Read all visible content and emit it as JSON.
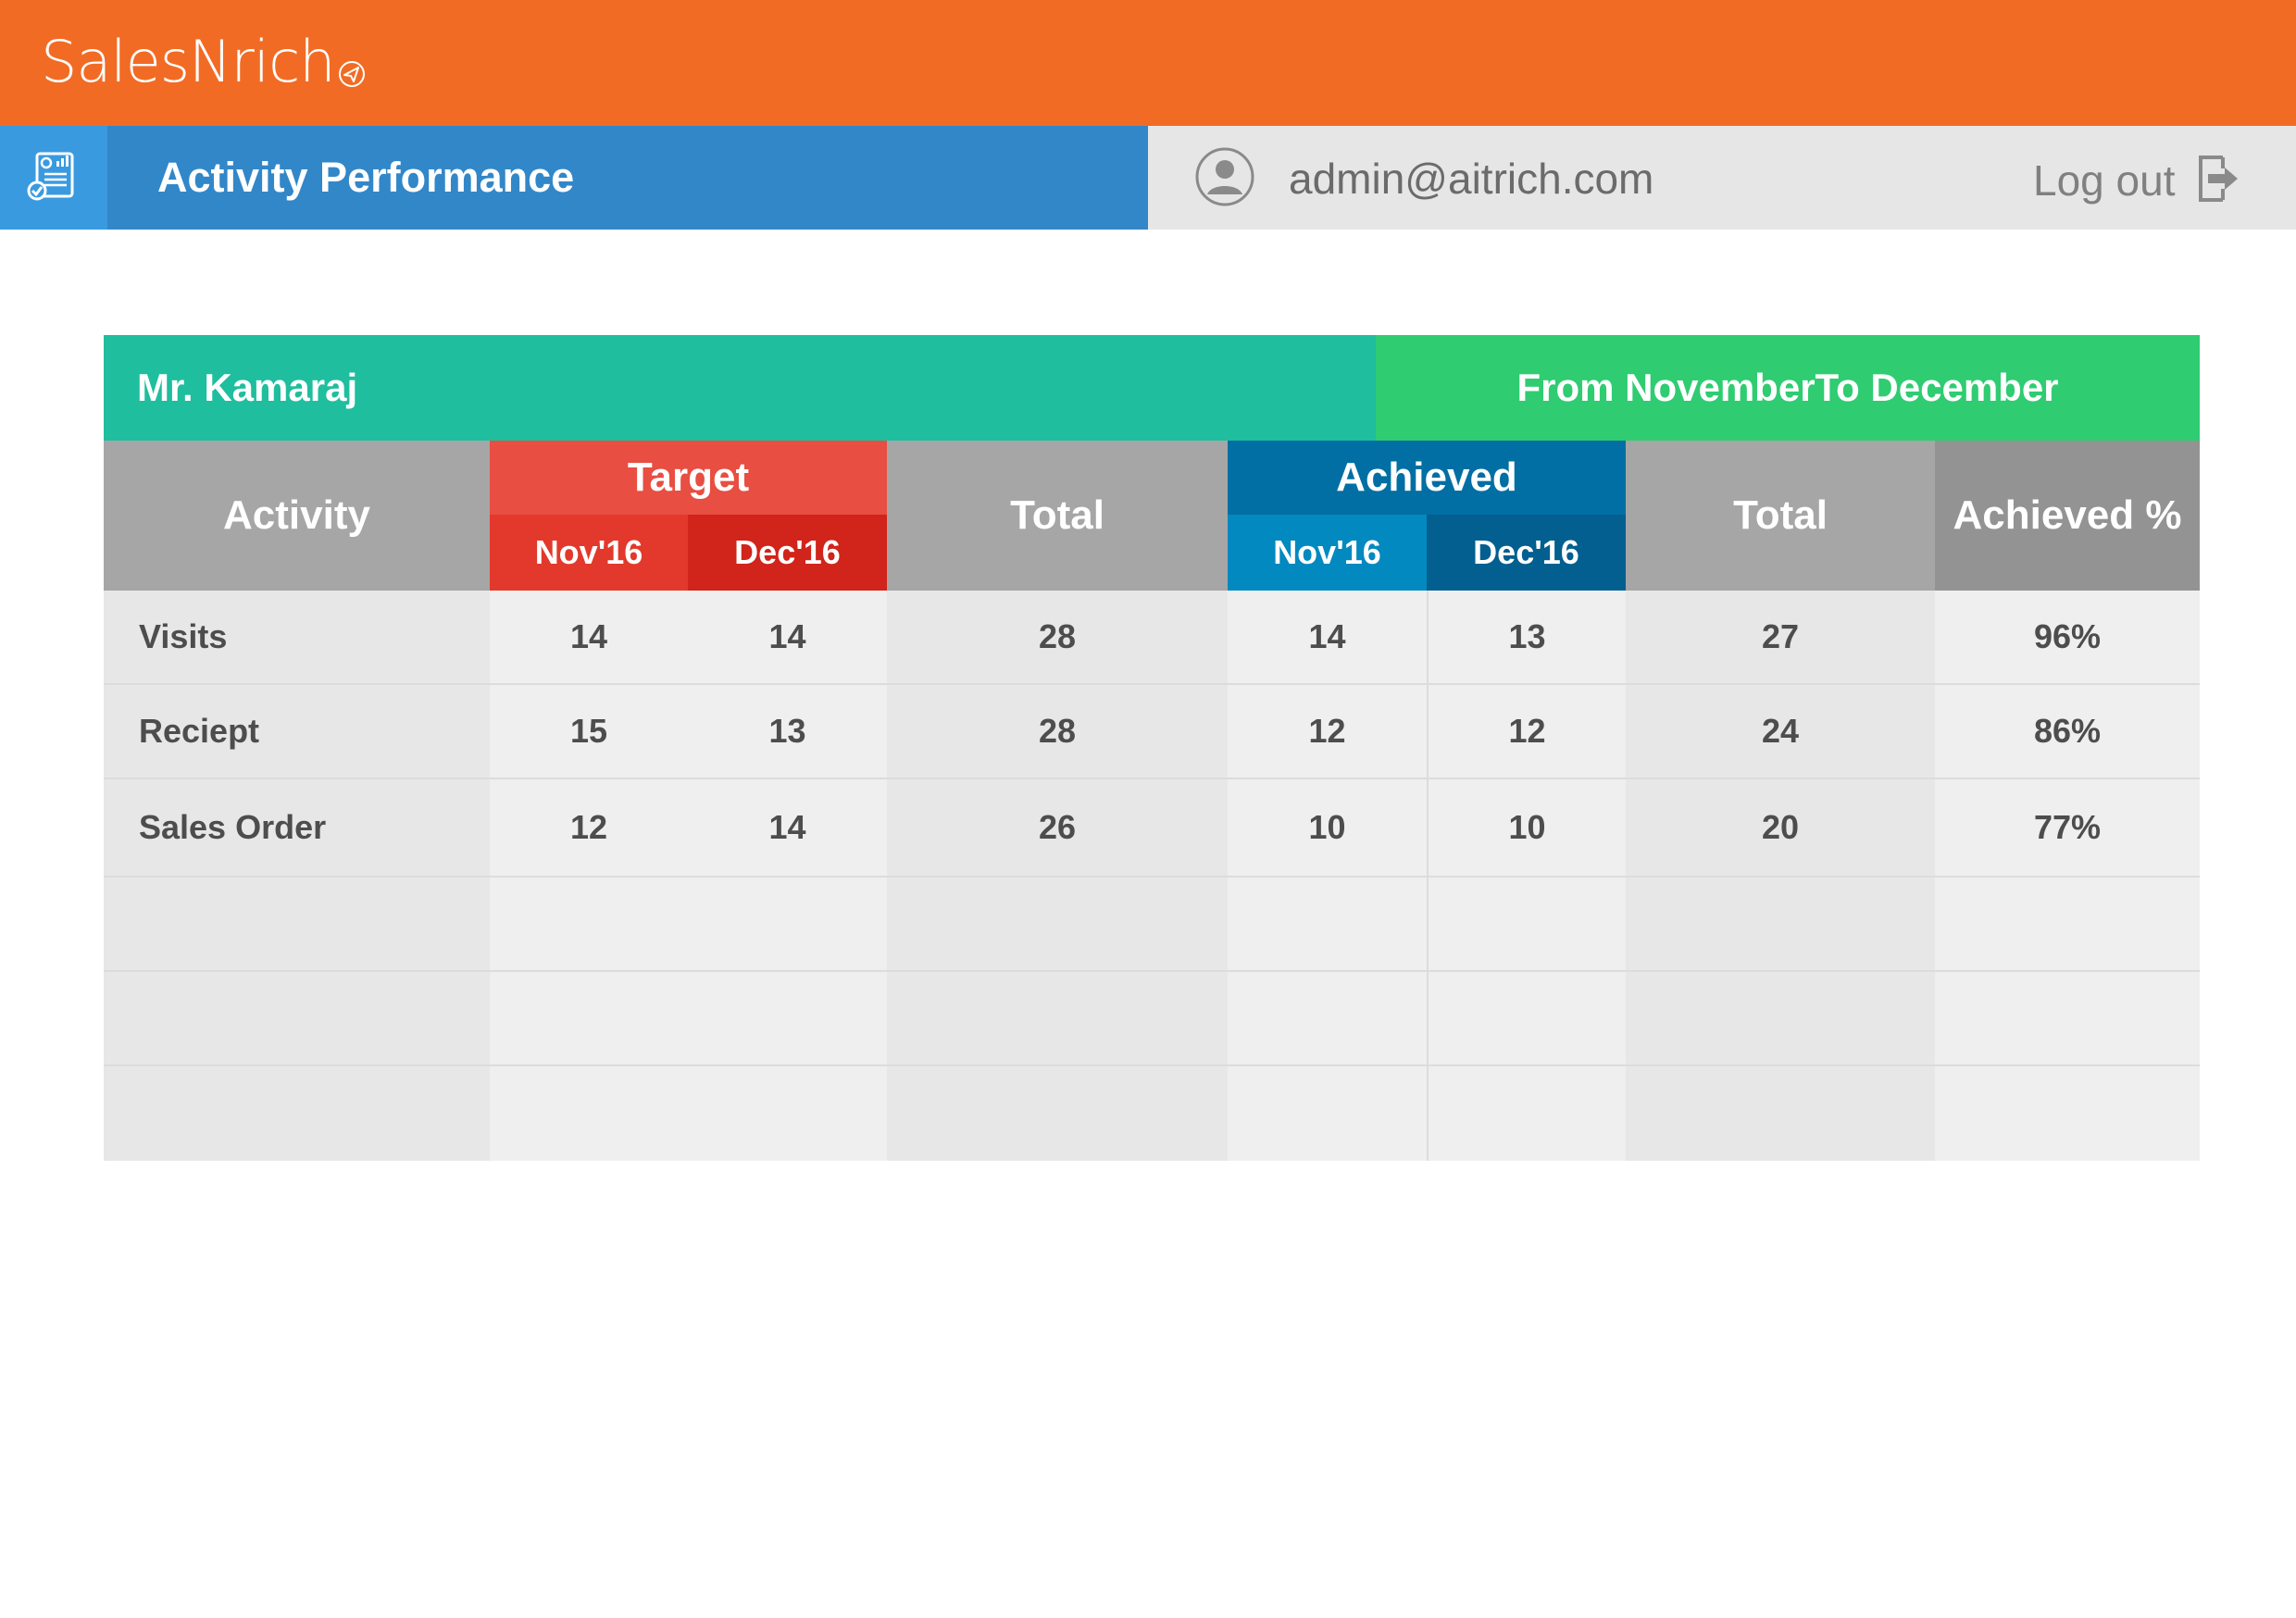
{
  "app": {
    "name": "SalesNrich"
  },
  "header": {
    "page_title": "Activity Performance",
    "user_email": "admin@aitrich.com",
    "logout_label": "Log out"
  },
  "report": {
    "person": "Mr. Kamaraj",
    "range": "From NovemberTo December",
    "columns": {
      "activity": "Activity",
      "target": "Target",
      "target_months": [
        "Nov'16",
        "Dec'16"
      ],
      "target_total": "Total",
      "achieved": "Achieved",
      "achieved_months": [
        "Nov'16",
        "Dec'16"
      ],
      "achieved_total": "Total",
      "achieved_pct": "Achieved %"
    },
    "rows": [
      {
        "activity": "Visits",
        "target_nov": "14",
        "target_dec": "14",
        "target_total": "28",
        "ach_nov": "14",
        "ach_dec": "13",
        "ach_total": "27",
        "pct": "96%"
      },
      {
        "activity": "Reciept",
        "target_nov": "15",
        "target_dec": "13",
        "target_total": "28",
        "ach_nov": "12",
        "ach_dec": "12",
        "ach_total": "24",
        "pct": "86%"
      },
      {
        "activity": "Sales Order",
        "target_nov": "12",
        "target_dec": "14",
        "target_total": "26",
        "ach_nov": "10",
        "ach_dec": "10",
        "ach_total": "20",
        "pct": "77%"
      }
    ]
  },
  "colors": {
    "brand_orange": "#f26b24",
    "title_blue": "#3287c9",
    "person_teal": "#1fbe9e",
    "range_green": "#2fcc72",
    "target_red": "#e84e41",
    "achieved_blue": "#016fa3"
  },
  "icons": {
    "page": "report-chart-icon",
    "user": "user-avatar-icon",
    "logout": "logout-icon"
  }
}
